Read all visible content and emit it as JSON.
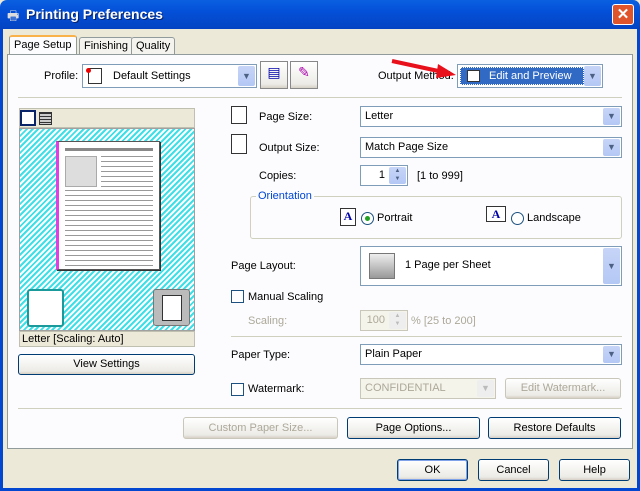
{
  "window": {
    "title": "Printing Preferences"
  },
  "tabs": [
    {
      "label": "Page Setup",
      "active": true
    },
    {
      "label": "Finishing"
    },
    {
      "label": "Quality"
    }
  ],
  "profile": {
    "label": "Profile:",
    "value": "Default Settings"
  },
  "output_method": {
    "label": "Output Method:",
    "value": "Edit and Preview"
  },
  "preview": {
    "caption": "Letter [Scaling: Auto]",
    "view_settings": "View Settings"
  },
  "page_size": {
    "label": "Page Size:",
    "value": "Letter"
  },
  "output_size": {
    "label": "Output Size:",
    "value": "Match Page Size"
  },
  "copies": {
    "label": "Copies:",
    "value": "1",
    "range": "[1 to 999]"
  },
  "orientation": {
    "label": "Orientation",
    "portrait": "Portrait",
    "landscape": "Landscape",
    "selected": "Portrait"
  },
  "page_layout": {
    "label": "Page Layout:",
    "value": "1 Page per Sheet"
  },
  "manual_scaling": {
    "label": "Manual Scaling",
    "checked": false
  },
  "scaling": {
    "label": "Scaling:",
    "value": "100",
    "range": "% [25 to 200]"
  },
  "paper_type": {
    "label": "Paper Type:",
    "value": "Plain Paper"
  },
  "watermark": {
    "label": "Watermark:",
    "value": "CONFIDENTIAL",
    "checked": false,
    "edit": "Edit Watermark..."
  },
  "buttons": {
    "custom_paper": "Custom Paper Size...",
    "page_options": "Page Options...",
    "restore": "Restore Defaults",
    "ok": "OK",
    "cancel": "Cancel",
    "help": "Help"
  },
  "colors": {
    "titlebar": "#0450d8",
    "accent_arrow": "#e8101a",
    "selection": "#316ac5"
  }
}
